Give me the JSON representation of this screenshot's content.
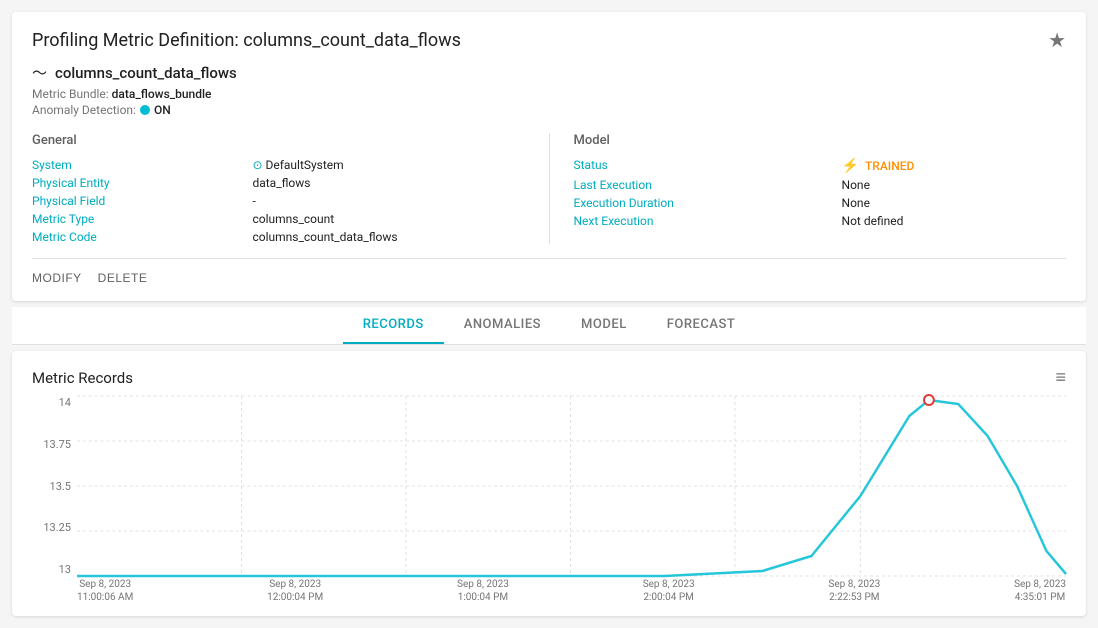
{
  "page": {
    "title": "Profiling Metric Definition: columns_count_data_flows",
    "star_label": "★"
  },
  "metric": {
    "icon": "〜",
    "name": "columns_count_data_flows",
    "bundle_label": "Metric Bundle:",
    "bundle_value": "data_flows_bundle",
    "anomaly_label": "Anomaly Detection:",
    "anomaly_status": "ON"
  },
  "general": {
    "title": "General",
    "fields": [
      {
        "label": "System",
        "value": ""
      },
      {
        "label": "Physical Entity",
        "value": "data_flows"
      },
      {
        "label": "Physical Field",
        "value": "-"
      },
      {
        "label": "Metric Type",
        "value": "columns_count"
      },
      {
        "label": "Metric Code",
        "value": "columns_count_data_flows"
      }
    ],
    "system_value": "DefaultSystem"
  },
  "model": {
    "title": "Model",
    "fields": [
      {
        "label": "Status",
        "value": "TRAINED"
      },
      {
        "label": "Last Execution",
        "value": "None"
      },
      {
        "label": "Execution Duration",
        "value": "None"
      },
      {
        "label": "Next Execution",
        "value": "Not defined"
      }
    ]
  },
  "actions": {
    "modify": "MODIFY",
    "delete": "DELETE"
  },
  "tabs": [
    {
      "id": "records",
      "label": "RECORDS",
      "active": true
    },
    {
      "id": "anomalies",
      "label": "ANOMALIES",
      "active": false
    },
    {
      "id": "model",
      "label": "MODEL",
      "active": false
    },
    {
      "id": "forecast",
      "label": "FORECAST",
      "active": false
    }
  ],
  "chart": {
    "title": "Metric Records",
    "y_labels": [
      "14",
      "13.75",
      "13.5",
      "13.25",
      "13"
    ],
    "x_labels": [
      "Sep 8, 2023 11:00:06 AM",
      "Sep 8, 2023 12:00:04 PM",
      "Sep 8, 2023 1:00:04 PM",
      "Sep 8, 2023 2:00:04 PM",
      "Sep 8, 2023 2:22:53 PM",
      "Sep 8, 2023 4:35:01 PM"
    ]
  }
}
